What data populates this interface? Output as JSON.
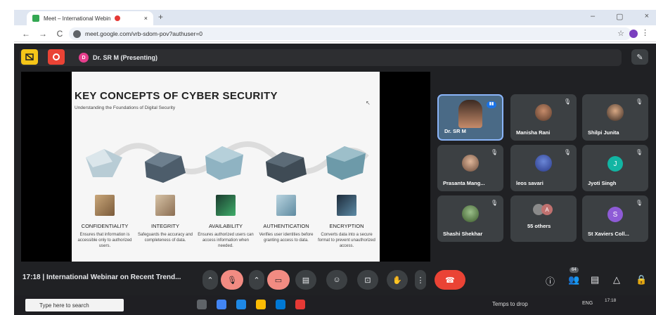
{
  "browser": {
    "tab_title": "Meet – International Webin",
    "tab_close": "×",
    "new_tab": "+",
    "url": "meet.google.com/vrb-sdom-pov?authuser=0",
    "nav_back": "←",
    "nav_forward": "→",
    "nav_reload": "C",
    "minimize": "–",
    "maximize": "▢",
    "close": "×",
    "star": "☆",
    "menu": "⋮"
  },
  "meet": {
    "presenter_initial": "D",
    "presenter_label": "Dr. SR M (Presenting)",
    "meeting_time": "17:18",
    "meeting_title": "International Webinar on Recent Trend...",
    "others_count_badge": "64"
  },
  "slide": {
    "title": "KEY CONCEPTS OF CYBER SECURITY",
    "subtitle": "Understanding the Foundations of Digital Security",
    "concepts": [
      {
        "title": "CONFIDENTIALITY",
        "desc": "Ensures that information is accessible only to authorized users."
      },
      {
        "title": "INTEGRITY",
        "desc": "Safeguards the accuracy and completeness of data."
      },
      {
        "title": "AVAILABILITY",
        "desc": "Ensures authorized users can access information when needed."
      },
      {
        "title": "AUTHENTICATION",
        "desc": "Verifies user identities before granting access to data."
      },
      {
        "title": "ENCRYPTION",
        "desc": "Converts data into a secure format to prevent unauthorized access."
      }
    ]
  },
  "participants": [
    {
      "name": "Dr. SR M",
      "type": "video"
    },
    {
      "name": "Manisha Rani",
      "type": "photo"
    },
    {
      "name": "Shilpi Junita",
      "type": "photo"
    },
    {
      "name": "Prasanta Mang...",
      "type": "photo"
    },
    {
      "name": "leos savari",
      "type": "photo"
    },
    {
      "name": "Jyoti Singh",
      "type": "letter",
      "letter": "J",
      "color": "#12b5a3"
    },
    {
      "name": "Shashi Shekhar",
      "type": "photo"
    },
    {
      "name": "55 others",
      "type": "group",
      "letter": "A"
    },
    {
      "name": "St Xaviers Coll...",
      "type": "letter",
      "letter": "S",
      "color": "#8e5bd6"
    }
  ],
  "taskbar": {
    "search_placeholder": "Type here to search",
    "weather": "Temps to drop",
    "lang": "ENG",
    "time": "17:18"
  },
  "colors": {
    "meet_bg": "#202124",
    "tile_bg": "#3c4043",
    "hangup": "#ea4335",
    "muted": "#f28b82",
    "slide_arrow_light": "#8fb3c2",
    "slide_arrow_dark": "#4d5d6b"
  }
}
